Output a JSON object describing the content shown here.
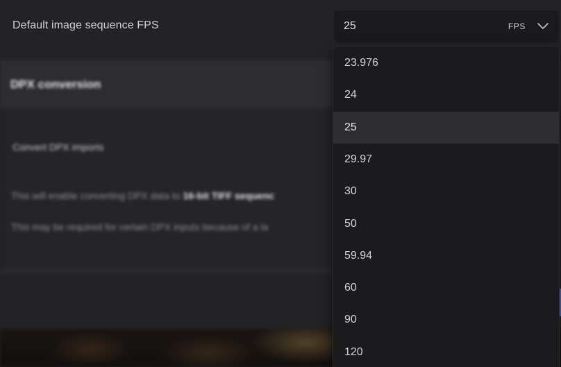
{
  "setting": {
    "label": "Default image sequence FPS",
    "value": "25",
    "unit": "FPS"
  },
  "dpx_section": {
    "title": "DPX conversion",
    "convert_label": "Convert DPX imports",
    "info_line_1_prefix": "This will enable converting DPX data to ",
    "info_line_1_bold": "16-bit TIFF sequenc",
    "info_line_2": "This may be required for certain DPX inputs because of a la"
  },
  "dropdown": {
    "selected": "25",
    "options": [
      "23.976",
      "24",
      "25",
      "29.97",
      "30",
      "50",
      "59.94",
      "60",
      "90",
      "120"
    ]
  },
  "colors": {
    "background": "#232325",
    "dropdown_bg": "#1b1b1d",
    "selected_bg": "#2e2e31",
    "accent_blue": "#3b6fd6"
  }
}
